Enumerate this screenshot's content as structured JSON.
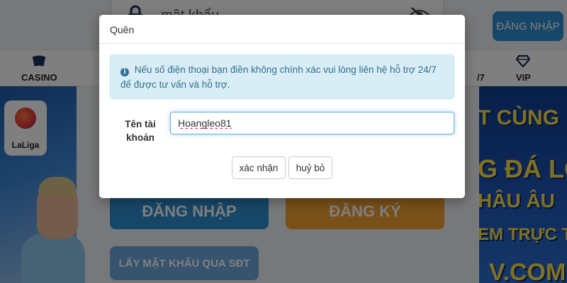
{
  "background": {
    "password_placeholder": "mật khẩu",
    "login_top_label": "ĐĂNG NHẬP",
    "nav": [
      {
        "label": "CASINO",
        "icon": "cards-icon"
      },
      {
        "label": "/7",
        "icon": ""
      },
      {
        "label": "VIP",
        "icon": "diamond-icon"
      }
    ],
    "laliga_label": "LaLiga",
    "banner_right_lines": [
      "T CÙNG",
      "G ĐÁ LỚ",
      "HÂU ÂU",
      "EM TRỰC TIẾ",
      "V.COM"
    ],
    "login_big_label": "ĐĂNG NHẬP",
    "register_big_label": "ĐĂNG KÝ",
    "sdt_label": "LẤY MẬT KHẨU QUA SĐT"
  },
  "modal": {
    "title": "Quên",
    "alert_icon": "i",
    "alert_text": "Nếu số điện thoại bạn điền không chính xác vui lòng liên hệ hỗ trợ 24/7 để được tư vấn và hỗ trợ.",
    "field_label": "Tên tài khoản",
    "field_value": "Hoangleo81",
    "confirm_label": "xác nhận",
    "cancel_label": "huỷ bỏ"
  },
  "colors": {
    "overlay": "rgba(0,0,0,0.5)",
    "login_blue": "#2f8fd0",
    "register_orange": "#f0a030",
    "alert_bg": "#d9edf7",
    "alert_text": "#31708f"
  }
}
